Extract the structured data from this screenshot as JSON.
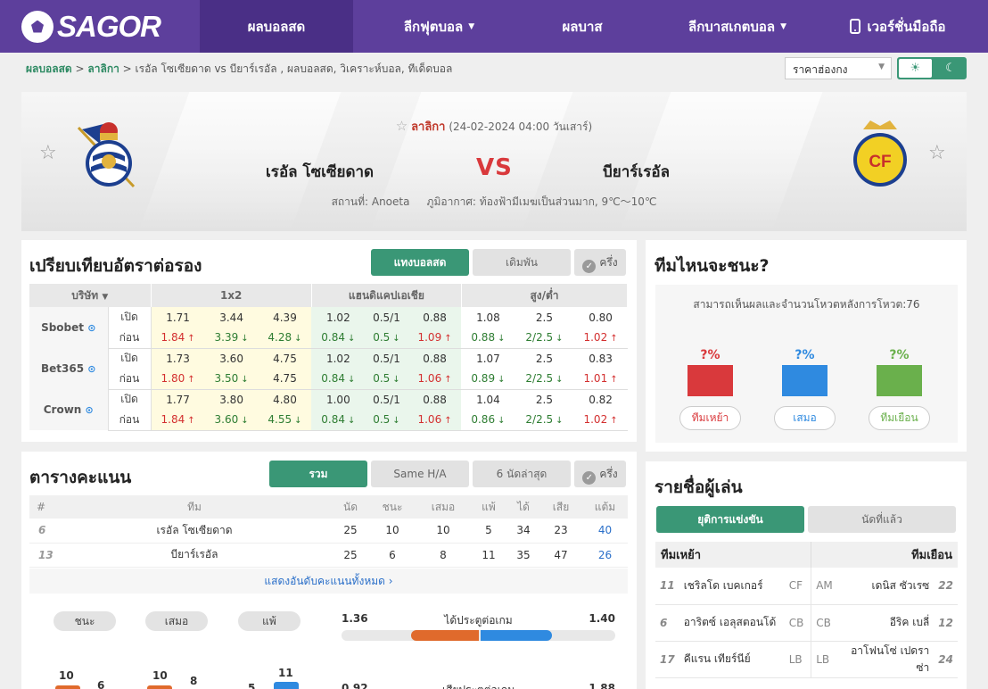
{
  "nav": {
    "logo": "SAGOR",
    "items": [
      "ผลบอลสด",
      "ลีกฟุตบอล",
      "ผลบาส",
      "ลีกบาสเกตบอล",
      "เวอร์ชั่นมือถือ"
    ]
  },
  "breadcrumb": {
    "home": "ผลบอลสด",
    "league": "ลาลิกา",
    "rest": "เรอัล โซเซียดาด vs  บียาร์เรอัล ,  ผลบอลสด,  วิเคราะห์บอล,  ทีเด็ดบอล"
  },
  "odds_select": "ราคาฮ่องกง",
  "match": {
    "league": "ลาลิกา",
    "datetime": "(24-02-2024 04:00 วันเสาร์)",
    "home": "เรอัล โซเซียดาด",
    "vs": "VS",
    "away": "บียาร์เรอัล",
    "venue": "สถานที่: Anoeta",
    "weather": "ภูมิอากาศ: ท้องฟ้ามีเมฆเป็นส่วนมาก, 9℃～10℃"
  },
  "odds": {
    "title": "เปรียบเทียบอัตราต่อรอง",
    "btn_live": "แทงบอลสด",
    "btn_more": "เดิมพัน",
    "btn_half": "ครึ่ง",
    "headers": [
      "บริษัท",
      "1x2",
      "แฮนดิแคปเอเชีย",
      "สูง/ต่ำ"
    ],
    "labels": {
      "open": "เปิด",
      "now": "ก่อน"
    },
    "rows": [
      {
        "book": "Sbobet",
        "open": [
          "1.71",
          "3.44",
          "4.39",
          "1.02",
          "0.5/1",
          "0.88",
          "1.08",
          "2.5",
          "0.80"
        ],
        "now": [
          "1.84",
          "3.39",
          "4.28",
          "0.84",
          "0.5",
          "1.09",
          "0.88",
          "2/2.5",
          "1.02"
        ],
        "dir": [
          "up",
          "dn",
          "dn",
          "dn",
          "dn",
          "up",
          "dn",
          "dn",
          "up"
        ]
      },
      {
        "book": "Bet365",
        "open": [
          "1.73",
          "3.60",
          "4.75",
          "1.02",
          "0.5/1",
          "0.88",
          "1.07",
          "2.5",
          "0.83"
        ],
        "now": [
          "1.80",
          "3.50",
          "4.75",
          "0.84",
          "0.5",
          "1.06",
          "0.89",
          "2/2.5",
          "1.01"
        ],
        "dir": [
          "up",
          "dn",
          "",
          "dn",
          "dn",
          "up",
          "dn",
          "dn",
          "up"
        ]
      },
      {
        "book": "Crown",
        "open": [
          "1.77",
          "3.80",
          "4.80",
          "1.00",
          "0.5/1",
          "0.88",
          "1.04",
          "2.5",
          "0.82"
        ],
        "now": [
          "1.84",
          "3.60",
          "4.55",
          "0.84",
          "0.5",
          "1.06",
          "0.86",
          "2/2.5",
          "1.02"
        ],
        "dir": [
          "up",
          "dn",
          "dn",
          "dn",
          "dn",
          "up",
          "dn",
          "dn",
          "up"
        ]
      }
    ]
  },
  "standings": {
    "title": "ตารางคะแนน",
    "btn_all": "รวม",
    "btn_ha": "Same H/A",
    "btn_last6": "6 นัดล่าสุด",
    "btn_half": "ครึ่ง",
    "headers": [
      "#",
      "ทีม",
      "นัด",
      "ชนะ",
      "เสมอ",
      "แพ้",
      "ได้",
      "เสีย",
      "แต้ม"
    ],
    "rows": [
      [
        "6",
        "เรอัล โซเซียดาด",
        "25",
        "10",
        "10",
        "5",
        "34",
        "23",
        "40"
      ],
      [
        "13",
        "บียาร์เรอัล",
        "25",
        "6",
        "8",
        "11",
        "35",
        "47",
        "26"
      ]
    ],
    "show_all": "แสดงอันดับคะแนนทั้งหมด",
    "pills": [
      "ชนะ",
      "เสมอ",
      "แพ้"
    ],
    "goals_for": {
      "label": "ได้ประตูต่อเกม",
      "home": "1.36",
      "away": "1.40",
      "home_share": 0.49
    },
    "goals_against": {
      "label": "เสียประตูต่อเกม",
      "home": "0.92",
      "away": "1.88"
    },
    "mini": [
      "10",
      "6",
      "10",
      "8",
      "5",
      "11"
    ]
  },
  "vote": {
    "title": "ทีมไหนจะชนะ?",
    "info": "สามารถเห็นผลและจำนวนโหวตหลังการโหวต:76",
    "pct": [
      "?%",
      "?%",
      "?%"
    ],
    "buttons": [
      "ทีมเหย้า",
      "เสมอ",
      "ทีมเยือน"
    ],
    "colors": [
      "#d9393c",
      "#2f8ae0",
      "#6ab04c"
    ]
  },
  "players": {
    "title": "รายชื่อผู้เล่น",
    "tab_active": "ยุติการแข่งขัน",
    "tab_other": "นัดที่แล้ว",
    "home_label": "ทีมเหย้า",
    "away_label": "ทีมเยือน",
    "rows": [
      {
        "hn": "11",
        "hname": "เชริลโด เบคเกอร์",
        "hpos": "CF",
        "apos": "AM",
        "aname": "เดนิส ซัวเรซ",
        "an": "22"
      },
      {
        "hn": "6",
        "hname": "อาริตซ์ เอลุสตอนโด้",
        "hpos": "CB",
        "apos": "CB",
        "aname": "อีริค เบลี่",
        "an": "12"
      },
      {
        "hn": "17",
        "hname": "คีแรน เทียร์นีย์",
        "hpos": "LB",
        "apos": "LB",
        "aname": "อาโฟนโซ่ เปดราซ่า",
        "an": "24"
      }
    ]
  }
}
